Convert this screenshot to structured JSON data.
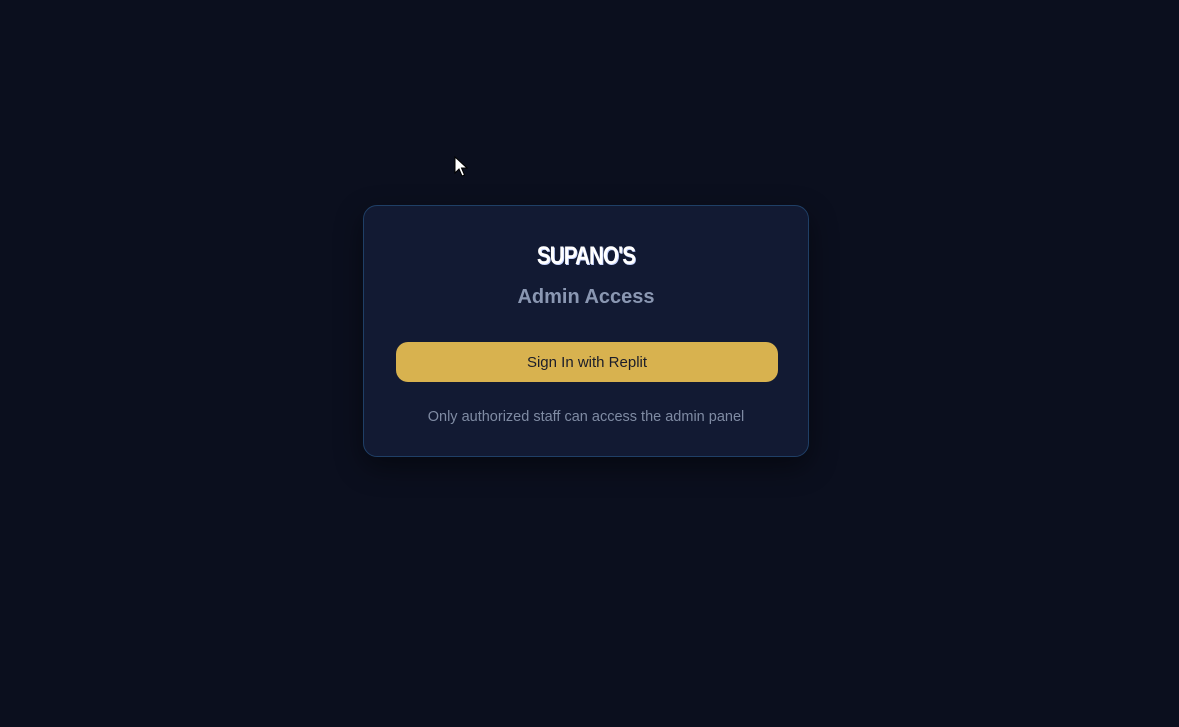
{
  "brand": {
    "name": "SUPANO'S"
  },
  "login": {
    "title": "Admin Access",
    "signin_label": "Sign In with Replit",
    "note": "Only authorized staff can access the admin panel"
  },
  "colors": {
    "background": "#0b0f1e",
    "card": "#121a33",
    "card_border": "#1f3f66",
    "accent": "#d8b24f",
    "muted_text": "#8a97b2"
  },
  "icons": {
    "cursor": "mouse-pointer-icon"
  }
}
